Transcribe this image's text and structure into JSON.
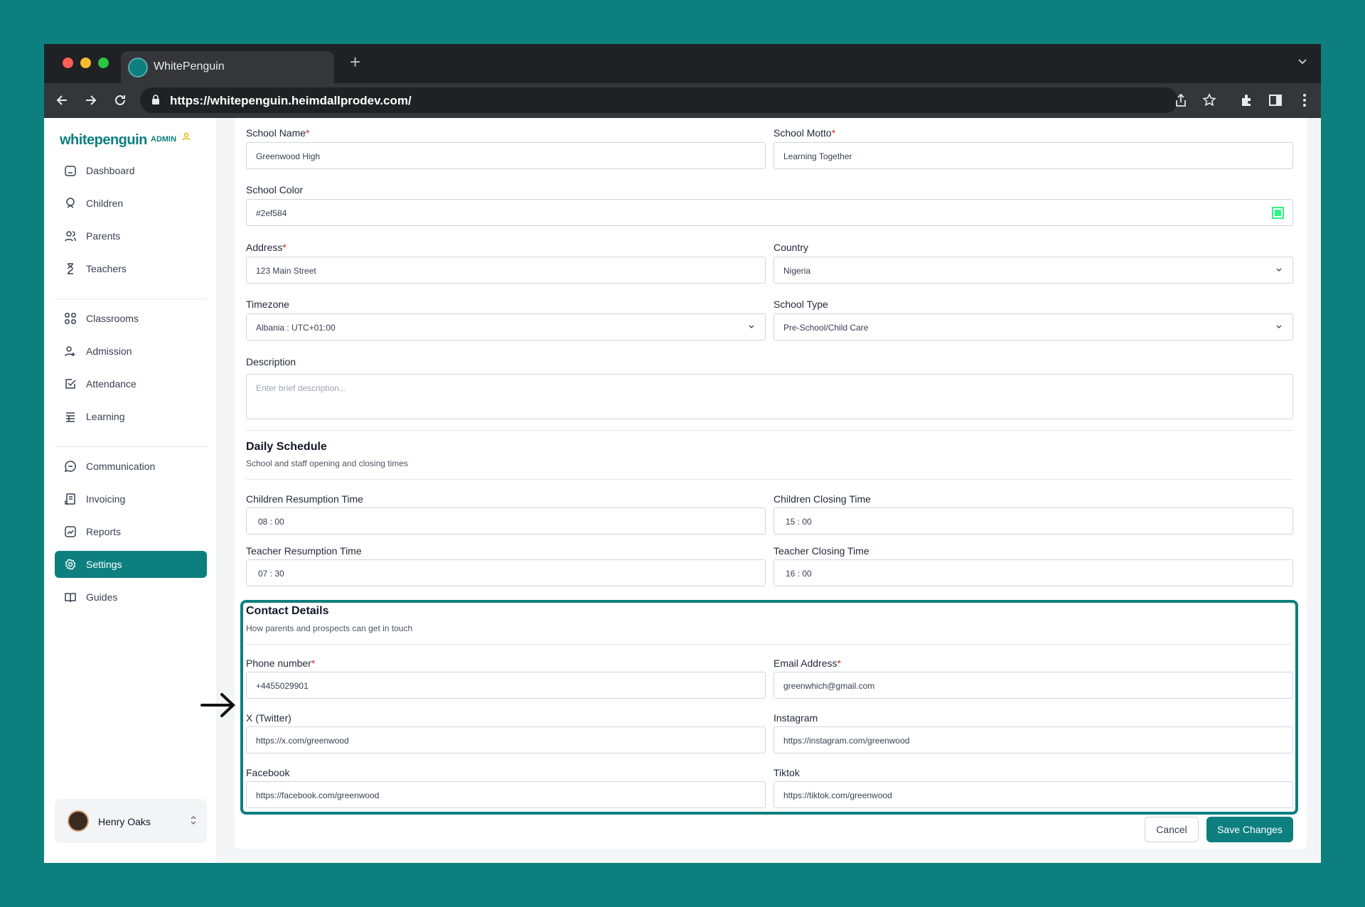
{
  "browser": {
    "tab_title": "WhitePenguin",
    "new_tab_symbol": "+",
    "url": "https://whitepenguin.heimdallprodev.com/"
  },
  "brand": {
    "logo": "whitepenguin",
    "role": "ADMIN",
    "accent_color": "#0d7f7f"
  },
  "sidebar": {
    "items": [
      {
        "label": "Dashboard",
        "icon": "home-icon"
      },
      {
        "label": "Children",
        "icon": "child-icon"
      },
      {
        "label": "Parents",
        "icon": "users-icon"
      },
      {
        "label": "Teachers",
        "icon": "teacher-icon"
      },
      {
        "label": "Classrooms",
        "icon": "grid-icon"
      },
      {
        "label": "Admission",
        "icon": "user-plus-icon"
      },
      {
        "label": "Attendance",
        "icon": "check-square-icon"
      },
      {
        "label": "Learning",
        "icon": "book-list-icon"
      },
      {
        "label": "Communication",
        "icon": "chat-icon"
      },
      {
        "label": "Invoicing",
        "icon": "invoice-icon"
      },
      {
        "label": "Reports",
        "icon": "chart-icon"
      },
      {
        "label": "Settings",
        "icon": "gear-icon",
        "active": true
      },
      {
        "label": "Guides",
        "icon": "book-open-icon"
      }
    ],
    "user": {
      "name": "Henry Oaks"
    }
  },
  "form": {
    "school_name": {
      "label": "School Name",
      "value": "Greenwood High"
    },
    "school_motto": {
      "label": "School Motto",
      "value": "Learning Together"
    },
    "school_color": {
      "label": "School Color",
      "value": "#2ef584"
    },
    "address": {
      "label": "Address",
      "value": "123 Main Street"
    },
    "country": {
      "label": "Country",
      "value": "Nigeria"
    },
    "timezone": {
      "label": "Timezone",
      "value": "Albania : UTC+01:00"
    },
    "school_type": {
      "label": "School Type",
      "value": "Pre-School/Child Care"
    },
    "description": {
      "label": "Description",
      "placeholder": "Enter brief description..."
    },
    "required_mark": "*"
  },
  "schedule": {
    "title": "Daily Schedule",
    "subtitle": "School and staff opening and closing times",
    "children_resumption": {
      "label": "Children Resumption Time",
      "value": "08 : 00"
    },
    "children_closing": {
      "label": "Children Closing Time",
      "value": "15 : 00"
    },
    "teacher_resumption": {
      "label": "Teacher Resumption Time",
      "value": "07 : 30"
    },
    "teacher_closing": {
      "label": "Teacher Closing Time",
      "value": "16 : 00"
    }
  },
  "contact": {
    "title": "Contact Details",
    "subtitle": "How parents and prospects can get in touch",
    "phone": {
      "label": "Phone number",
      "value": "+4455029901"
    },
    "email": {
      "label": "Email Address",
      "value": "greenwhich@gmail.com"
    },
    "twitter": {
      "label": "X (Twitter)",
      "value": "https://x.com/greenwood"
    },
    "instagram": {
      "label": "Instagram",
      "value": "https://instagram.com/greenwood"
    },
    "facebook": {
      "label": "Facebook",
      "value": "https://facebook.com/greenwood"
    },
    "tiktok": {
      "label": "Tiktok",
      "value": "https://tiktok.com/greenwood"
    }
  },
  "actions": {
    "cancel": "Cancel",
    "save": "Save Changes"
  }
}
